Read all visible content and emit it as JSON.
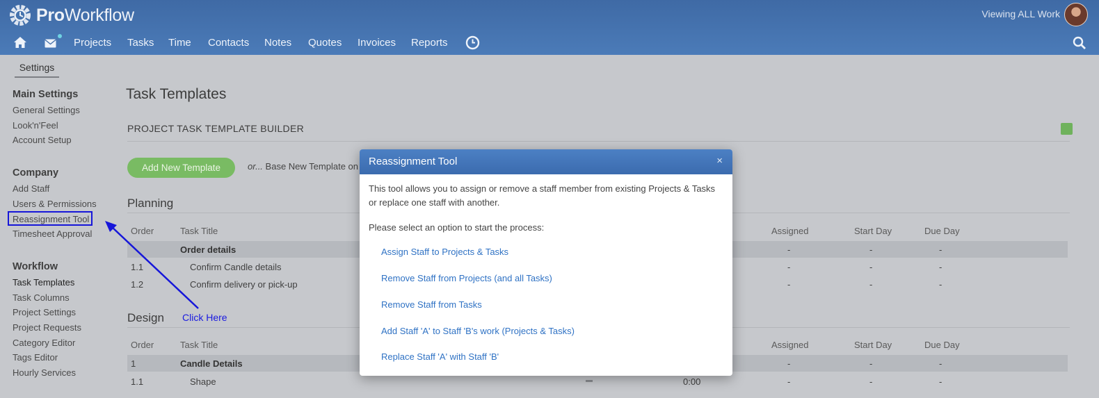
{
  "header": {
    "brand_bold": "Pro",
    "brand_light": "Workflow",
    "viewing": "Viewing ALL Work"
  },
  "nav": {
    "items": [
      "Projects",
      "Tasks",
      "Time",
      "Contacts",
      "Notes",
      "Quotes",
      "Invoices",
      "Reports"
    ],
    "icons": [
      "home-icon",
      "mail-icon",
      "clock-icon",
      "search-icon"
    ]
  },
  "sidebar": {
    "tab": "Settings",
    "sections": [
      {
        "title": "Main Settings",
        "items": [
          "General Settings",
          "Look'n'Feel",
          "Account Setup"
        ]
      },
      {
        "title": "Company",
        "items": [
          "Add Staff",
          "Users & Permissions",
          "Reassignment Tool",
          "Timesheet Approval"
        ]
      },
      {
        "title": "Workflow",
        "items": [
          "Task Templates",
          "Task Columns",
          "Project Settings",
          "Project Requests",
          "Category Editor",
          "Tags Editor",
          "Hourly Services"
        ]
      }
    ]
  },
  "main": {
    "title": "Task Templates",
    "builder_heading": "PROJECT TASK TEMPLATE BUILDER",
    "add_button": "Add New Template",
    "or_text": "or...",
    "base_text": "Base New Template on",
    "columns": {
      "order": "Order",
      "task_title": "Task Title",
      "assigned": "Assigned",
      "start_day": "Start Day",
      "due_day": "Due Day"
    },
    "sections": [
      {
        "title": "Planning",
        "rows": [
          {
            "order": "",
            "title": "Order details",
            "assigned": "-",
            "start": "-",
            "due": "-"
          },
          {
            "order": "1.1",
            "title": "Confirm Candle details",
            "assigned": "-",
            "start": "-",
            "due": "-"
          },
          {
            "order": "1.2",
            "title": "Confirm delivery or pick-up",
            "assigned": "-",
            "start": "-",
            "due": "-"
          }
        ]
      },
      {
        "title": "Design",
        "rows": [
          {
            "order": "1",
            "title": "Candle Details",
            "assigned": "-",
            "start": "-",
            "due": "-"
          },
          {
            "order": "1.1",
            "title": "Shape",
            "time": "0:00",
            "assigned": "-",
            "start": "-",
            "due": "-"
          }
        ]
      }
    ]
  },
  "annotation": {
    "click_here": "Click Here"
  },
  "modal": {
    "title": "Reassignment Tool",
    "close": "×",
    "intro": "This tool allows you to assign or remove a staff member from existing Projects & Tasks or replace one staff with another.",
    "prompt": "Please select an option to start the process:",
    "options": [
      "Assign Staff to Projects & Tasks",
      "Remove Staff from Projects (and all Tasks)",
      "Remove Staff from Tasks",
      "Add Staff 'A' to Staff 'B's work (Projects & Tasks)",
      "Replace Staff 'A' with Staff 'B'"
    ]
  },
  "colors": {
    "header": "#4470ab",
    "background": "#c6c8cc",
    "link": "#2f72c4",
    "button": "#79bb63",
    "annotation": "#1616d9"
  }
}
